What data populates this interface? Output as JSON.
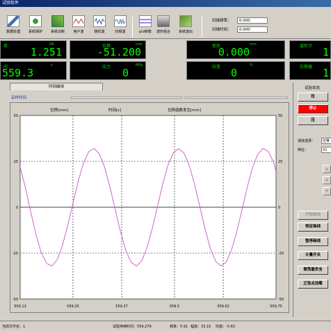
{
  "window": {
    "title": "试验软件"
  },
  "toolbar": {
    "items": [
      {
        "label": "数据处理",
        "icon": "data-process-icon"
      },
      {
        "label": "系统保护",
        "icon": "protect-icon"
      },
      {
        "label": "系统诊断",
        "icon": "diagnose-icon"
      },
      {
        "label": "用户波",
        "icon": "user-wave-icon"
      },
      {
        "label": "随机波",
        "icon": "random-wave-icon"
      },
      {
        "label": "扫频波",
        "icon": "sweep-wave-icon"
      },
      {
        "label": "pid参数",
        "icon": "pid-icon"
      },
      {
        "label": "波形组合",
        "icon": "wave-combine-icon"
      },
      {
        "label": "系统退出",
        "icon": "exit-icon"
      }
    ],
    "scan_freq_label": "扫描频率：",
    "scan_freq_value": "0.000",
    "scan_time_label": "扫描时间：",
    "scan_time_value": "0.000"
  },
  "panels": {
    "row1": [
      {
        "label": "荷",
        "unit": "kN",
        "value": "1.251"
      },
      {
        "label": "位移",
        "unit": "mm",
        "value": "-51.200"
      },
      {
        "label": "变形",
        "unit": "mm",
        "value": "0.000"
      },
      {
        "label": "波形计",
        "unit": "",
        "value": "1"
      }
    ],
    "row2": [
      {
        "label": "间",
        "unit": "s",
        "value": "559.3"
      },
      {
        "label": "应力",
        "unit": "MPa",
        "value": "0"
      },
      {
        "label": "应变",
        "unit": "%",
        "value": "0"
      },
      {
        "label": "位移器",
        "unit": "",
        "value": "1"
      }
    ]
  },
  "chart_tab": {
    "label": "时间曲线",
    "sampling_label": "采样时间"
  },
  "chart_data": {
    "type": "line",
    "legend": [
      "位移[mm]",
      "时间[s]",
      "位移函数发生[mm]"
    ],
    "x": {
      "min": 559.12,
      "max": 559.75,
      "ticks": [
        "559.12",
        "559.25",
        "559.37",
        "559.5",
        "559.62",
        "559.75"
      ]
    },
    "y": {
      "min": -50,
      "max": 50,
      "ticks": [
        "50",
        "25",
        "0",
        "-25",
        "-50"
      ]
    },
    "series": [
      {
        "name": "位移函数发生[mm]",
        "color": "#cc66cc",
        "x": [
          559.12,
          559.133,
          559.146,
          559.159,
          559.172,
          559.185,
          559.198,
          559.211,
          559.224,
          559.237,
          559.25,
          559.263,
          559.276,
          559.289,
          559.302,
          559.315,
          559.328,
          559.341,
          559.354,
          559.367,
          559.38,
          559.393,
          559.406,
          559.419,
          559.432,
          559.445,
          559.458,
          559.471,
          559.484,
          559.497,
          559.51,
          559.523,
          559.536,
          559.549,
          559.562,
          559.575,
          559.588,
          559.601,
          559.614,
          559.627,
          559.64,
          559.653,
          559.666,
          559.679,
          559.692,
          559.705,
          559.718,
          559.731,
          559.744,
          559.75
        ],
        "y": [
          22.0,
          10.5,
          -2.5,
          -15.0,
          -24.8,
          -30.6,
          -32.0,
          -28.7,
          -21.0,
          -10.1,
          2.1,
          14.2,
          24.1,
          30.3,
          32.0,
          29.0,
          21.7,
          11.0,
          -1.2,
          -13.4,
          -23.6,
          -30.0,
          -32.0,
          -29.3,
          -22.3,
          -11.9,
          0.3,
          12.6,
          23.0,
          29.7,
          31.9,
          29.6,
          22.9,
          12.8,
          0.6,
          -11.7,
          -22.5,
          -29.4,
          -32.0,
          -30.0,
          -23.5,
          -13.7,
          -1.5,
          10.8,
          21.6,
          28.9,
          32.0,
          30.4,
          24.4,
          19.2
        ]
      }
    ]
  },
  "right_panel": {
    "title": "试验状态",
    "btn_up": "拉",
    "btn_stop": "停止",
    "btn_down": "压",
    "channel_label": "通道选择：",
    "channel_value": "位移",
    "speed_label": "档位：",
    "speed_value": "X1",
    "buttons": [
      "开始画线",
      "恒定画线",
      "暂停画线",
      "计量开关",
      "振荡最安全",
      "正弦点加载"
    ]
  },
  "status": {
    "file": "当前文件名：1",
    "run_time": "试验持续时间：559.279",
    "freq": "频率：5.91",
    "amp": "幅值：33.15",
    "mean": "均值：-0.63"
  }
}
